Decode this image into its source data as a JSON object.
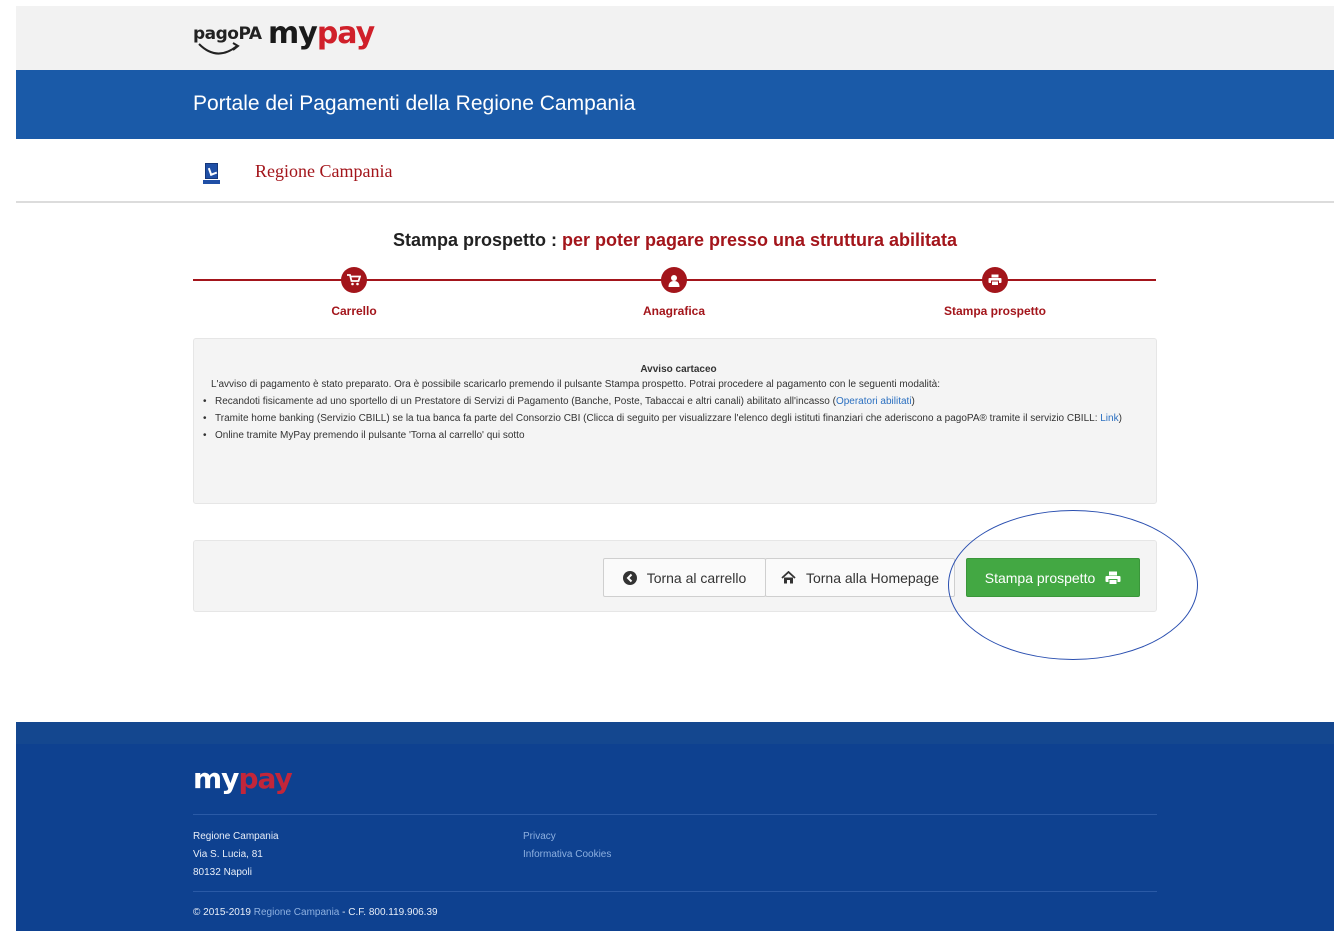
{
  "brand": {
    "pagopa": "pagoPA",
    "mypay_my": "my",
    "mypay_pay": "pay"
  },
  "header": {
    "title": "Portale dei Pagamenti della Regione Campania"
  },
  "region": {
    "name": "Regione Campania"
  },
  "page": {
    "title_main": "Stampa prospetto : ",
    "title_accent": "per poter pagare presso una struttura abilitata"
  },
  "steps": [
    {
      "label": "Carrello",
      "icon": "cart-icon"
    },
    {
      "label": "Anagrafica",
      "icon": "user-icon"
    },
    {
      "label": "Stampa prospetto",
      "icon": "print-icon"
    }
  ],
  "notice": {
    "heading": "Avviso cartaceo",
    "intro": "L'avviso di pagamento è stato preparato. Ora è possibile scaricarlo premendo il pulsante Stampa prospetto. Potrai procedere al pagamento con le seguenti modalità:",
    "item1_text": "Recandoti fisicamente ad uno sportello di un Prestatore di Servizi di Pagamento (Banche, Poste, Tabaccai e altri canali) abilitato all'incasso (",
    "item1_link": "Operatori abilitati",
    "item1_end": ")",
    "item2_text": "Tramite home banking (Servizio CBILL) se la tua banca fa parte del Consorzio CBI (Clicca di seguito per visualizzare l'elenco degli istituti finanziari che aderiscono a pagoPA® tramite il servizio CBILL: ",
    "item2_link": "Link",
    "item2_end": ")",
    "item3_text": "Online tramite MyPay premendo il pulsante 'Torna al carrello' qui sotto"
  },
  "actions": {
    "back_cart": "Torna al carrello",
    "back_home": "Torna alla Homepage",
    "print": "Stampa prospetto"
  },
  "colors": {
    "header_blue": "#1a5aa8",
    "accent_red": "#a3151b",
    "print_green": "#43a843",
    "footer_blue": "#0e4190"
  },
  "footer": {
    "addr_line1": "Regione Campania",
    "addr_line2": "Via S. Lucia, 81",
    "addr_line3": "80132 Napoli",
    "link_privacy": "Privacy",
    "link_cookies": "Informativa Cookies",
    "copy_prefix": "© 2015-2019 ",
    "copy_link": "Regione Campania",
    "copy_suffix": " - C.F. 800.119.906.39"
  }
}
